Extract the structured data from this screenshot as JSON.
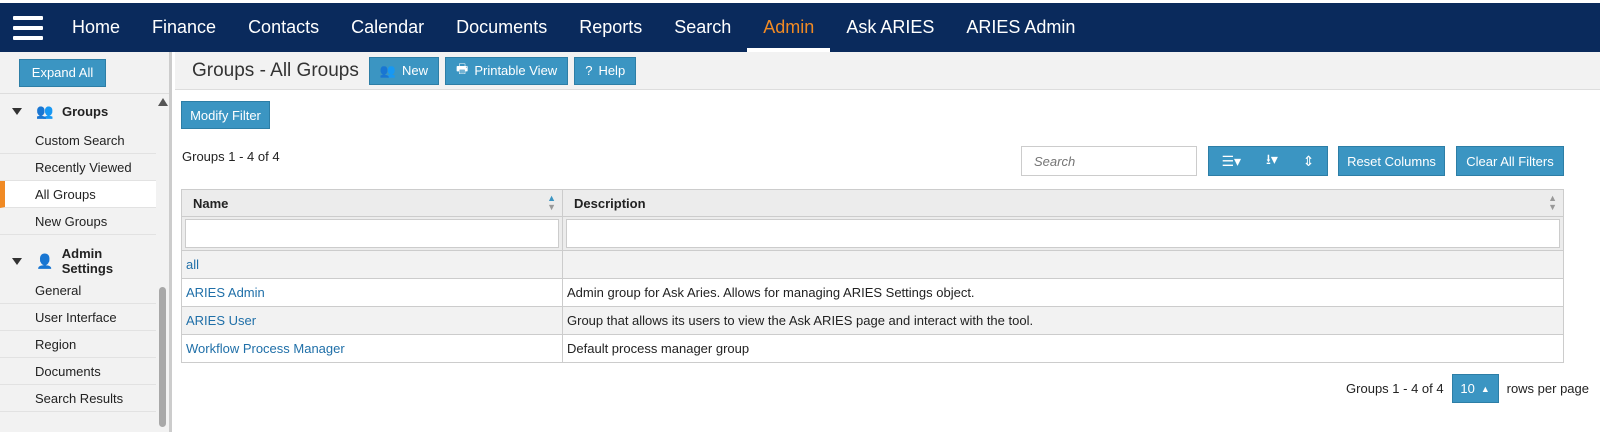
{
  "nav": {
    "items": [
      {
        "label": "Home"
      },
      {
        "label": "Finance"
      },
      {
        "label": "Contacts"
      },
      {
        "label": "Calendar"
      },
      {
        "label": "Documents"
      },
      {
        "label": "Reports"
      },
      {
        "label": "Search"
      },
      {
        "label": "Admin",
        "active": true
      },
      {
        "label": "Ask ARIES"
      },
      {
        "label": "ARIES Admin"
      }
    ]
  },
  "sidebar": {
    "expand_all": "Expand All",
    "groups_section": {
      "label": "Groups",
      "items": [
        "Custom Search",
        "Recently Viewed",
        "All Groups",
        "New Groups"
      ],
      "active": "All Groups"
    },
    "admin_section": {
      "label": "Admin Settings",
      "items": [
        "General",
        "User Interface",
        "Region",
        "Documents",
        "Search Results"
      ]
    }
  },
  "titlebar": {
    "title": "Groups - All Groups",
    "new_label": "New",
    "printable_label": "Printable View",
    "help_label": "Help"
  },
  "toolbar": {
    "modify_filter": "Modify Filter",
    "count": "Groups 1 - 4 of 4",
    "search_placeholder": "Search",
    "reset_columns": "Reset Columns",
    "clear_filters": "Clear All Filters"
  },
  "table": {
    "columns": [
      "Name",
      "Description"
    ],
    "rows": [
      {
        "name": "all",
        "description": ""
      },
      {
        "name": "ARIES Admin",
        "description": "Admin group for Ask Aries. Allows for managing ARIES Settings object."
      },
      {
        "name": "ARIES User",
        "description": "Group that allows its users to view the Ask ARIES page and interact with the tool."
      },
      {
        "name": "Workflow Process Manager",
        "description": "Default process manager group"
      }
    ]
  },
  "pager": {
    "count": "Groups 1 - 4 of 4",
    "rows_per_page_value": "10",
    "rows_per_page_label": "rows per page"
  },
  "colors": {
    "nav_bg": "#0a2a5c",
    "accent": "#f08a24",
    "button": "#3b95c2",
    "link": "#1f6fa8"
  }
}
